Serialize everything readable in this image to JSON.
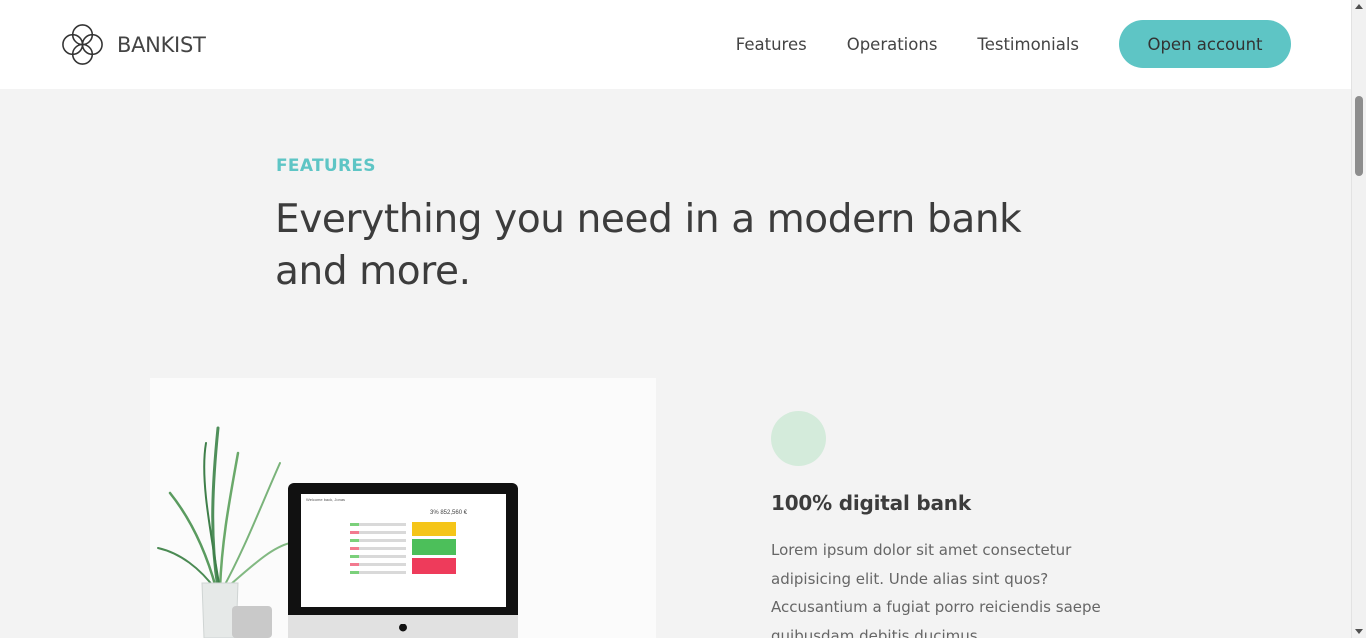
{
  "brand": {
    "name": "BANKIST",
    "accent_color": "#5ec5c5"
  },
  "nav": {
    "links": [
      "Features",
      "Operations",
      "Testimonials"
    ],
    "cta_label": "Open account"
  },
  "section": {
    "label": "FEATURES",
    "title": "Everything you need in a modern bank and more."
  },
  "feature": {
    "icon": "digital-bank-icon",
    "title": "100% digital bank",
    "text": "Lorem ipsum dolor sit amet consectetur adipisicing elit. Unde alias sint quos? Accusantium a fugiat porro reiciendis saepe quibusdam debitis ducimus.",
    "image_alt": "computer",
    "screen": {
      "header_left": "Welcome back, Jonas",
      "balance": "3% 852,560 €"
    }
  }
}
